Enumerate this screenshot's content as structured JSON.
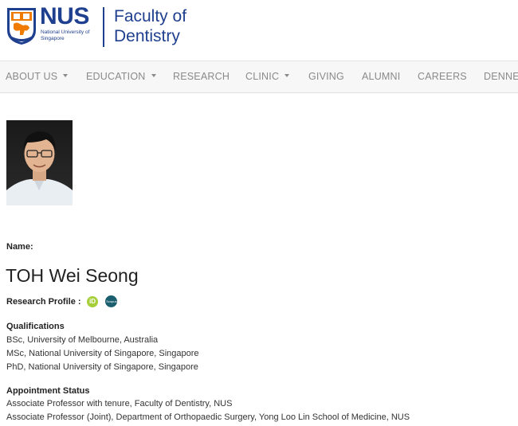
{
  "header": {
    "logo_name": "NUS",
    "logo_sub": "National University of Singapore",
    "faculty_line1": "Faculty of",
    "faculty_line2": "Dentistry"
  },
  "nav": {
    "items": [
      {
        "label": "ABOUT US",
        "dropdown": true
      },
      {
        "label": "EDUCATION",
        "dropdown": true
      },
      {
        "label": "RESEARCH",
        "dropdown": false
      },
      {
        "label": "CLINIC",
        "dropdown": true
      },
      {
        "label": "GIVING",
        "dropdown": false
      },
      {
        "label": "ALUMNI",
        "dropdown": false
      },
      {
        "label": "CAREERS",
        "dropdown": false
      },
      {
        "label": "DENNET",
        "dropdown": false
      }
    ]
  },
  "profile": {
    "name_label": "Name:",
    "name": "TOH Wei Seong",
    "research_profile_label": "Research Profile :",
    "orcid_icon": "iD",
    "scopus_icon": "Scopus",
    "qualifications_title": "Qualifications",
    "qualifications": [
      "BSc, University of Melbourne, Australia",
      "MSc, National University of Singapore, Singapore",
      "PhD, National University of Singapore, Singapore"
    ],
    "appointment_title": "Appointment Status",
    "appointments": [
      "Associate Professor with tenure, Faculty of Dentistry, NUS",
      "Associate Professor (Joint), Department of Orthopaedic Surgery, Yong Loo Lin School of Medicine, NUS"
    ]
  },
  "colors": {
    "brand_blue": "#1f3f8f",
    "brand_orange": "#ef7c00",
    "orcid_green": "#a6ce39",
    "scopus_teal": "#1b5e6e"
  }
}
